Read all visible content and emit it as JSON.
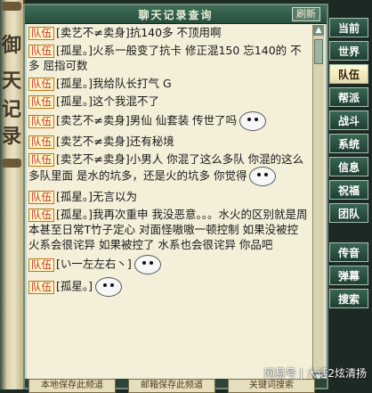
{
  "window": {
    "title": "聊天记录查询",
    "refresh_label": "刷新"
  },
  "left_scroll": {
    "chars": [
      "御",
      "天",
      "记",
      "录"
    ]
  },
  "messages": [
    {
      "tag": "队伍",
      "text": "[卖艺不≠卖身]抗140多 不顶用啊"
    },
    {
      "tag": "队伍",
      "text": "[孤星。]火系一般变了抗卡 修正混150 忘140的 不多 屈指可数"
    },
    {
      "tag": "队伍",
      "text": "[孤星。]我给队长打气 G"
    },
    {
      "tag": "队伍",
      "text": "[孤星。]这个我混不了"
    },
    {
      "tag": "队伍",
      "text": "[卖艺不≠卖身]男仙 仙套装 传世了吗"
    },
    {
      "tag": "队伍",
      "text": "[卖艺不≠卖身]还有秘境"
    },
    {
      "tag": "队伍",
      "text": "[卖艺不≠卖身]小男人 你混了这么多队 你混的这么多队里面 是水的坑多，还是火的坑多 你觉得"
    },
    {
      "tag": "队伍",
      "text": "[孤星。]无言以为"
    },
    {
      "tag": "队伍",
      "text": "[孤星。]我再次重申 我没恶意。。。水火的区别就是周本甚至日常T竹子定心 对面怪嗷嗷一顿控制 如果没被控 火系会很诧异 如果被控了 水系也会很诧异 你品吧"
    },
    {
      "tag": "队伍",
      "text": "[い一左左右丶]"
    },
    {
      "tag": "队伍",
      "text": "[孤星。]"
    }
  ],
  "tabs": [
    "当前",
    "世界",
    "队伍",
    "帮派",
    "战斗",
    "系统",
    "信息",
    "祝福",
    "团队",
    "传音",
    "弹幕",
    "搜索"
  ],
  "active_tab": "队伍",
  "bottom_buttons": [
    "本地保存此频道",
    "邮箱保存此频道",
    "关键词搜索"
  ],
  "watermark": "网易号 | 大话2炫清扬",
  "colors": {
    "tag_red": "#c0392b",
    "title_green": "#284e3d",
    "parchment": "#f3efd9"
  }
}
